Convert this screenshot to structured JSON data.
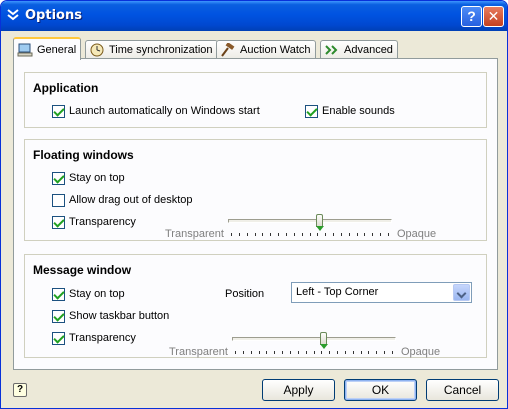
{
  "window": {
    "title": "Options",
    "help_glyph": "?",
    "close_glyph": "✕",
    "title_icon": "chevron-double-down-icon"
  },
  "tabs": [
    {
      "label": "General",
      "icon": "computer-icon",
      "active": true
    },
    {
      "label": "Time synchronization",
      "icon": "clock-icon",
      "active": false
    },
    {
      "label": "Auction Watch",
      "icon": "gavel-icon",
      "active": false
    },
    {
      "label": "Advanced",
      "icon": "double-arrow-icon",
      "active": false
    }
  ],
  "application": {
    "title": "Application",
    "launch_label": "Launch automatically on Windows start",
    "launch_checked": true,
    "sounds_label": "Enable sounds",
    "sounds_checked": true
  },
  "floating": {
    "title": "Floating windows",
    "stay_on_top_label": "Stay on top",
    "stay_on_top_checked": true,
    "drag_label": "Allow drag out of desktop",
    "drag_checked": false,
    "transparency_label": "Transparency",
    "transparency_checked": true,
    "slider_min_label": "Transparent",
    "slider_max_label": "Opaque",
    "slider_value": 0.56
  },
  "message": {
    "title": "Message window",
    "stay_on_top_label": "Stay on top",
    "stay_on_top_checked": true,
    "taskbar_label": "Show taskbar button",
    "taskbar_checked": true,
    "transparency_label": "Transparency",
    "transparency_checked": true,
    "position_label": "Position",
    "position_value": "Left - Top Corner",
    "slider_min_label": "Transparent",
    "slider_max_label": "Opaque",
    "slider_value": 0.56
  },
  "buttons": {
    "help_glyph": "?",
    "apply": "Apply",
    "ok": "OK",
    "cancel": "Cancel"
  },
  "colors": {
    "titlebar": "#0053e1",
    "face": "#ece9d8",
    "check": "#21a121"
  }
}
